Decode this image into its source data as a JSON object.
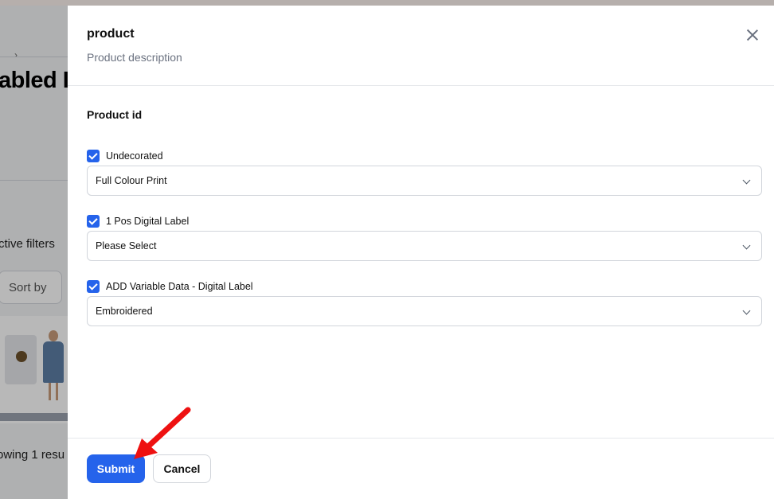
{
  "background": {
    "crumb": "›",
    "title": "abled I",
    "filters_label": "ctive filters",
    "sort_label": "Sort by",
    "results_text": "owing 1 resu"
  },
  "modal": {
    "title": "product",
    "description": "Product description",
    "section_label": "Product id",
    "options": [
      {
        "label": "Undecorated",
        "checked": true,
        "selected": "Full Colour Print"
      },
      {
        "label": "1 Pos Digital Label",
        "checked": true,
        "selected": "Please Select"
      },
      {
        "label": "ADD Variable Data - Digital Label",
        "checked": true,
        "selected": "Embroidered"
      }
    ],
    "submit_label": "Submit",
    "cancel_label": "Cancel"
  },
  "colors": {
    "primary": "#2563eb",
    "annotation_arrow": "#ee1111"
  }
}
